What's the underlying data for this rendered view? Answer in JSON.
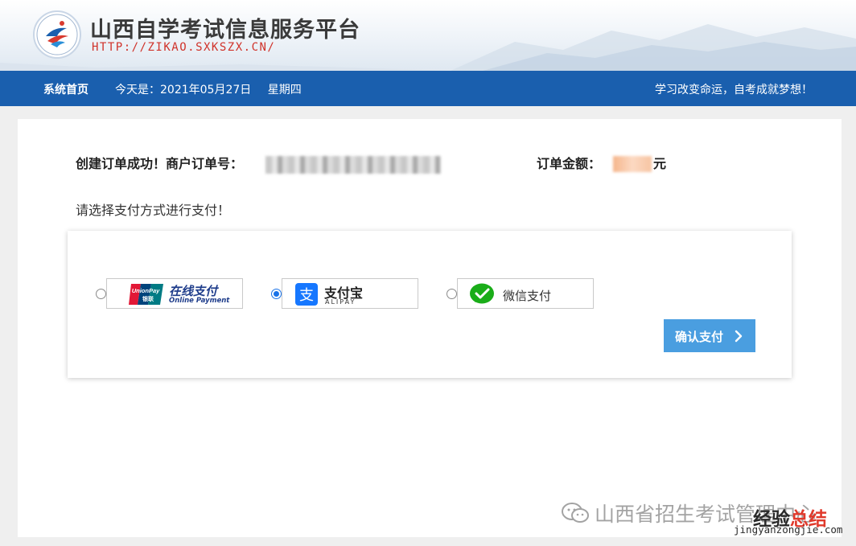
{
  "header": {
    "site_title": "山西自学考试信息服务平台",
    "site_url": "HTTP://ZIKAO.SXKSZX.CN/"
  },
  "nav": {
    "home": "系统首页",
    "date_prefix": "今天是：2021年05月27日",
    "weekday": "星期四",
    "slogan": "学习改变命运，自考成就梦想！"
  },
  "order": {
    "success_label": "创建订单成功！商户订单号：",
    "amount_label": "订单金额：",
    "amount_unit": "元",
    "choose_tip": "请选择支付方式进行支付！"
  },
  "payment": {
    "selected": "alipay",
    "options": [
      {
        "id": "unionpay",
        "name": "在线支付",
        "subtitle": "Online Payment",
        "logo_text": "UnionPay",
        "logo_sub": "银联"
      },
      {
        "id": "alipay",
        "name": "支付宝",
        "subtitle": "ALIPAY",
        "logo_text": "支"
      },
      {
        "id": "wechat",
        "name": "微信支付"
      }
    ],
    "confirm_label": "确认支付"
  },
  "watermark": {
    "wechat_account": "山西省招生考试管理中心",
    "site_name_1": "经验",
    "site_name_2": "总结",
    "site_url": "jingyanzongjie.com"
  },
  "colors": {
    "navbar": "#1a5fae",
    "url_red": "#d0322a",
    "confirm_button": "#4a9ee0",
    "alipay_blue": "#1677ff",
    "wechat_green": "#1aad19"
  }
}
